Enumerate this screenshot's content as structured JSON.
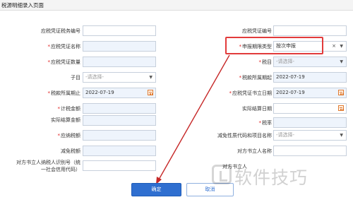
{
  "title": "税源明细录入页面",
  "placeholder_select": "-请选择-",
  "left": {
    "l1": "应税凭证税务编号",
    "l2": "应税凭证名称",
    "l3": "应税凭证数量",
    "l4": "子目",
    "l5": "税款所属期止",
    "l5_value": "2022-07-19",
    "l6": "计税金额",
    "l7": "实际结算金额",
    "l8": "应纳税额",
    "l9": "减免税额",
    "l10a": "对方书立人纳税人识别号（统",
    "l10b": "一社会信用代码）"
  },
  "right": {
    "r1": "应税凭证编号",
    "r2": "申报期限类型",
    "r2_value": "按次申报",
    "r2_clear": "×",
    "r3": "税目",
    "r4": "税款所属期起",
    "r4_value": "2022-07-19",
    "r5": "应税凭证书立日期",
    "r5_value": "2022-07-19",
    "r6": "实际结算日期",
    "r7": "税率",
    "r8": "减免性质代码和项目名称",
    "r9": "对方书立人名称",
    "r10": "对方书立人"
  },
  "buttons": {
    "confirm": "确定",
    "cancel": "取消"
  },
  "watermark": "软件技巧",
  "colors": {
    "primary": "#2f6fd0",
    "required": "#e02020",
    "highlight": "#e23b3b",
    "field_bg": "#eef4fc"
  }
}
